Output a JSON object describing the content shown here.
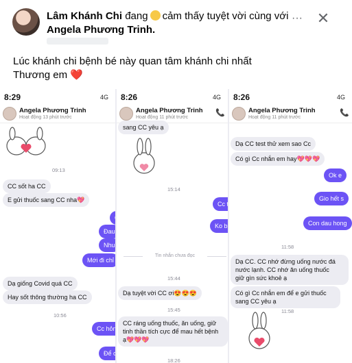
{
  "post": {
    "author": "Lâm Khánh Chi",
    "pre_emoji": "đang",
    "feeling": "cảm thấy tuyệt vời cùng với",
    "with_name": "Angela Phương Trinh.",
    "caption_line1": "Lúc khánh chi bệnh bé này quan tâm khánh chi nhất",
    "caption_line2": "Thương em",
    "caption_heart": "❤️",
    "more_label": "···",
    "close_label": "✕"
  },
  "panels": [
    {
      "time": "8:29",
      "network": "4G",
      "contact": "Angela Phương Trinh",
      "status": "Hoạt động 13 phút trước",
      "messages": {
        "ts1": "09:13",
        "m1": "CC sốt ha CC",
        "m2": "E gửi thuốc sang CC nha💖",
        "o1": "C",
        "o2": "Đau",
        "o3": "Nhu",
        "o4": "Mới đi chỉ",
        "m3": "Dạ giống Covid quá CC",
        "m4": "Hay sốt thông thường ha CC",
        "ts2": "10:56",
        "o5": "Cc hỏng",
        "o6": "Để c"
      }
    },
    {
      "time": "8:26",
      "network": "4G",
      "contact": "Angela Phương Trinh",
      "status": "Hoạt động 11 phút trước",
      "messages": {
        "m0": "sang CC yêu ạ",
        "ts1": "15:14",
        "o1": "Cc te",
        "o2": "Ko bi",
        "unread": "Tin nhắn chưa đọc",
        "ts2": "15:44",
        "m1": "Dạ tuyệt vời CC ơi😍😍😍",
        "ts3": "15:45",
        "m2a": "CC ráng uống thuốc, ăn uống, giữ",
        "m2b": "tinh thần tích cực để mau hết bệnh",
        "m2c": "ạ💖💖💖",
        "ts4": "18:26"
      }
    },
    {
      "time": "8:26",
      "network": "4G",
      "contact": "Angela Phương Trinh",
      "status": "Hoạt động 11 phút trước",
      "messages": {
        "m1": "Dạ CC test thử xem sao Cc",
        "m2": "Có gì Cc nhắn em hay💖💖💖",
        "o1": "Ok e",
        "o2": "Gio hết s",
        "o3": "Con dau hong",
        "ts1": "11:58",
        "m3a": "Dạ CC. CC nhớ đừng uống nước đá",
        "m3b": "nước lạnh. CC nhớ ăn uống thuốc",
        "m3c": "giữ gìn sức khoẻ ạ",
        "m4a": "Có gì Cc nhắn em để e gửi thuốc",
        "m4b": "sang CC yêu ạ",
        "ts2": "11:58"
      }
    }
  ],
  "colors": {
    "outgoing": "#6c53f5",
    "incoming": "#ececf2",
    "heart": "#e53935"
  },
  "icons": {
    "more": "more-icon",
    "close": "close-icon",
    "call": "phone-icon",
    "emoji": "grinning-emoji-icon"
  }
}
